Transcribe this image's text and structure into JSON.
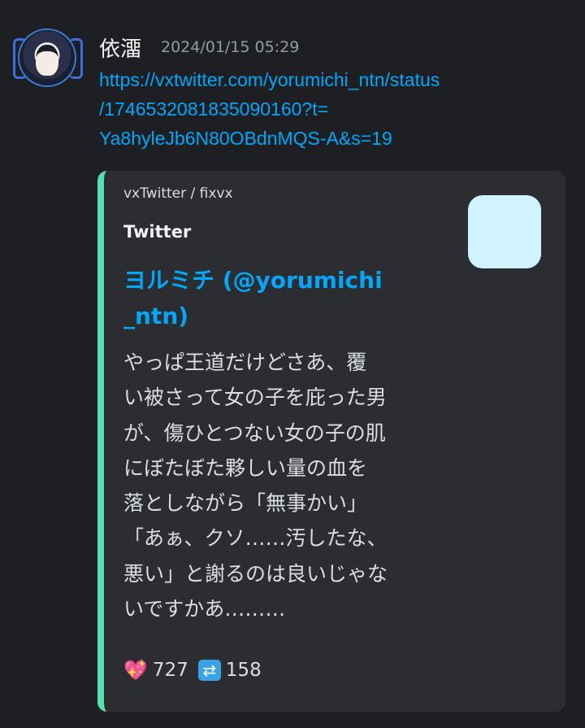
{
  "message": {
    "username": "依澑",
    "timestamp": "2024/01/15 05:29",
    "link_lines": [
      "https://vxtwitter.com/yorumichi_ntn/status",
      "/1746532081835090160?t=",
      "Ya8hyleJb6N80OBdnMQS-A&s=19"
    ]
  },
  "embed": {
    "accent_color": "#55e0b0",
    "provider": "vxTwitter / fixvx",
    "author": "Twitter",
    "title": "ヨルミチ (@yorumichi_ntn)",
    "body_lines": [
      "やっぱ王道だけどさあ、覆",
      "い被さって女の子を庇った男",
      "が、傷ひとつない女の子の肌",
      "にぼたぼた夥しい量の血を",
      "落としながら「無事かい」",
      "「あぁ、クソ……汚したな、",
      "悪い」と謝るのは良いじゃな",
      "いですかあ………"
    ],
    "likes": "727",
    "retweets": "158",
    "like_icon": "sparkling-heart-icon",
    "retweet_icon": "repeat-icon"
  }
}
